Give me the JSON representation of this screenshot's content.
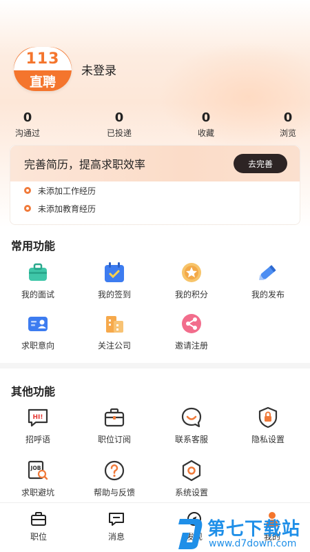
{
  "profile": {
    "avatar_number": "113",
    "avatar_brand": "直聘",
    "login_status": "未登录"
  },
  "stats": [
    {
      "value": "0",
      "label": "沟通过"
    },
    {
      "value": "0",
      "label": "已投递"
    },
    {
      "value": "0",
      "label": "收藏"
    },
    {
      "value": "0",
      "label": "浏览"
    }
  ],
  "resume": {
    "title": "完善简历，提高求职效率",
    "button_label": "去完善",
    "todos": [
      "未添加工作经历",
      "未添加教育经历"
    ]
  },
  "common": {
    "title": "常用功能",
    "items": [
      {
        "label": "我的面试",
        "icon": "briefcase-icon"
      },
      {
        "label": "我的签到",
        "icon": "calendar-check-icon"
      },
      {
        "label": "我的积分",
        "icon": "star-coin-icon"
      },
      {
        "label": "我的发布",
        "icon": "pencil-icon"
      },
      {
        "label": "求职意向",
        "icon": "id-card-icon"
      },
      {
        "label": "关注公司",
        "icon": "building-icon"
      },
      {
        "label": "邀请注册",
        "icon": "share-icon"
      }
    ]
  },
  "other": {
    "title": "其他功能",
    "items": [
      {
        "label": "招呼语",
        "icon": "hi-bubble-icon"
      },
      {
        "label": "职位订阅",
        "icon": "briefcase-outline-icon"
      },
      {
        "label": "联系客服",
        "icon": "headset-bubble-icon"
      },
      {
        "label": "隐私设置",
        "icon": "lock-shield-icon"
      },
      {
        "label": "求职避坑",
        "icon": "job-search-icon"
      },
      {
        "label": "帮助与反馈",
        "icon": "question-circle-icon"
      },
      {
        "label": "系统设置",
        "icon": "hex-gear-icon"
      }
    ]
  },
  "tabbar": [
    {
      "label": "职位",
      "icon": "briefcase-tab-icon"
    },
    {
      "label": "消息",
      "icon": "message-tab-icon"
    },
    {
      "label": "发现",
      "icon": "discover-tab-icon"
    },
    {
      "label": "我的",
      "icon": "user-tab-icon"
    }
  ],
  "watermark": {
    "text": "第七下载站",
    "url": "www.d7down.com"
  },
  "colors": {
    "accent": "#f4752d",
    "dark_button": "#2d2424",
    "watermark": "#1f8fe8"
  }
}
